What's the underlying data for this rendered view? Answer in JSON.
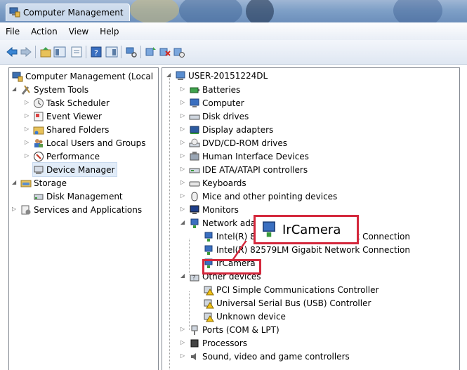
{
  "window": {
    "title": "Computer Management"
  },
  "menu": [
    "File",
    "Action",
    "View",
    "Help"
  ],
  "tree_left": [
    {
      "label": "Computer Management (Local",
      "level": 0
    },
    {
      "label": "System Tools",
      "level": 1
    },
    {
      "label": "Task Scheduler",
      "level": 2
    },
    {
      "label": "Event Viewer",
      "level": 2
    },
    {
      "label": "Shared Folders",
      "level": 2
    },
    {
      "label": "Local Users and Groups",
      "level": 2
    },
    {
      "label": "Performance",
      "level": 2
    },
    {
      "label": "Device Manager",
      "level": 2,
      "selected": true
    },
    {
      "label": "Storage",
      "level": 1
    },
    {
      "label": "Disk Management",
      "level": 2
    },
    {
      "label": "Services and Applications",
      "level": 1
    }
  ],
  "tree_right": {
    "root": "USER-20151224DL",
    "items": [
      "Batteries",
      "Computer",
      "Disk drives",
      "Display adapters",
      "DVD/CD-ROM drives",
      "Human Interface Devices",
      "IDE ATA/ATAPI controllers",
      "Keyboards",
      "Mice and other pointing devices",
      "Monitors",
      "Network adapters",
      "Intel(R) 82579LM Gigabit Network Connection",
      "Intel(R) 82579LM Gigabit Network Connection",
      "IrCamera",
      "Other devices",
      "PCI Simple Communications Controller",
      "Universal Serial Bus (USB) Controller",
      "Unknown device",
      "Ports (COM & LPT)",
      "Processors",
      "Sound, video and game controllers"
    ]
  },
  "callout": {
    "label": "IrCamera"
  },
  "colors": {
    "highlight": "#d4283c",
    "selection": "#e1ecf8"
  }
}
